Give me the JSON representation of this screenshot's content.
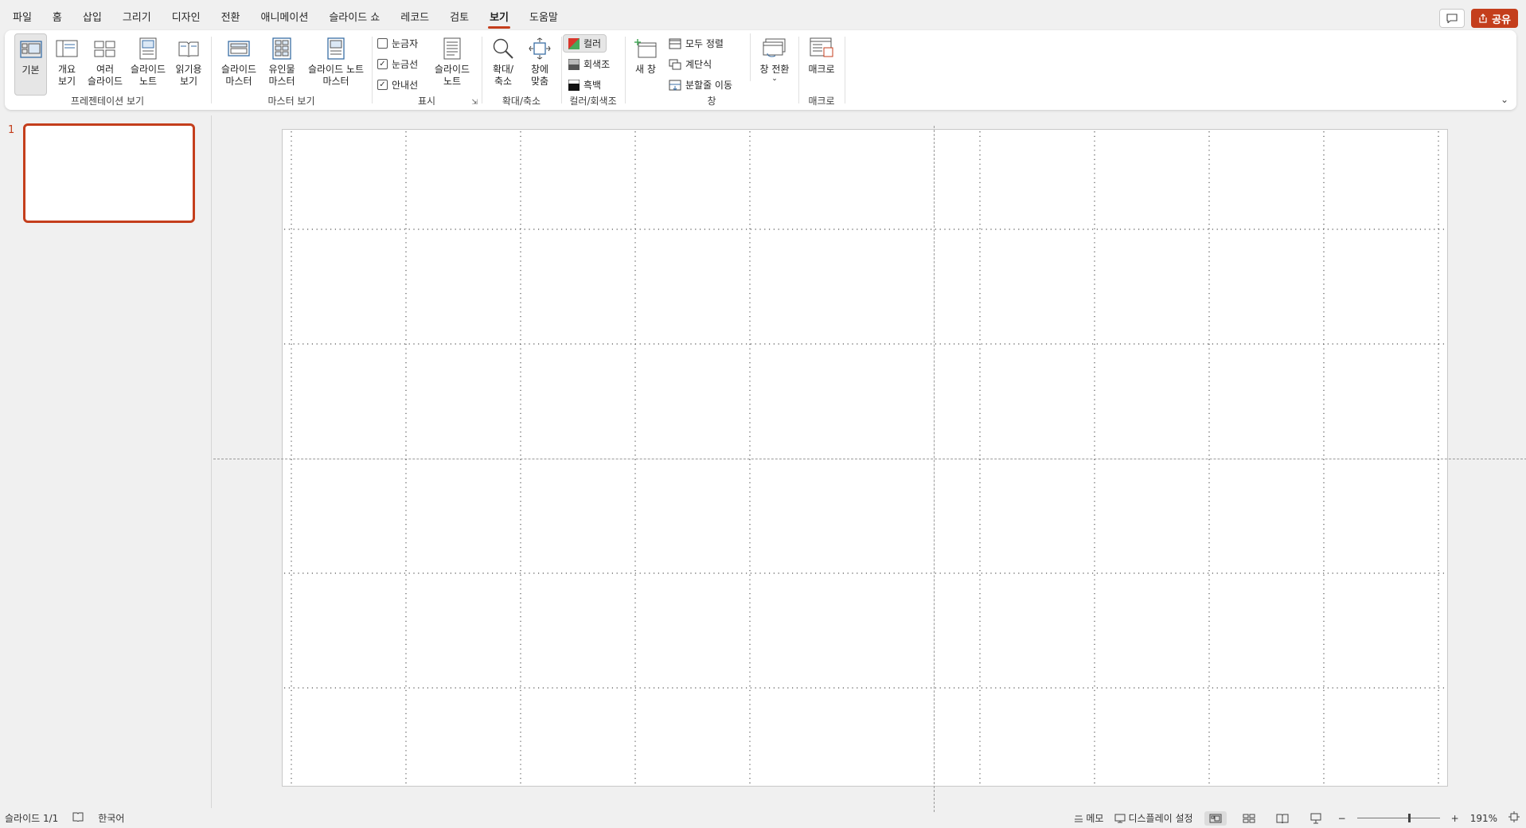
{
  "menu": {
    "items": [
      "파일",
      "홈",
      "삽입",
      "그리기",
      "디자인",
      "전환",
      "애니메이션",
      "슬라이드 쇼",
      "레코드",
      "검토",
      "보기",
      "도움말"
    ],
    "active": "보기",
    "share_label": "공유"
  },
  "ribbon": {
    "presentation_views": {
      "label": "프레젠테이션 보기",
      "normal": "기본",
      "outline": "개요\n보기",
      "sorter": "여러\n슬라이드",
      "notes_page": "슬라이드\n노트",
      "reading": "읽기용\n보기"
    },
    "master_views": {
      "label": "마스터 보기",
      "slide_master": "슬라이드\n마스터",
      "handout_master": "유인물\n마스터",
      "notes_master": "슬라이드 노트\n마스터"
    },
    "show": {
      "label": "표시",
      "ruler": "눈금자",
      "ruler_checked": false,
      "gridlines": "눈금선",
      "gridlines_checked": true,
      "guides": "안내선",
      "guides_checked": true,
      "notes": "슬라이드\n노트"
    },
    "zoom": {
      "label": "확대/축소",
      "zoom": "확대/\n축소",
      "fit": "창에\n맞춤"
    },
    "color": {
      "label": "컬러/회색조",
      "color": "컬러",
      "grayscale": "회색조",
      "bw": "흑백"
    },
    "window": {
      "label": "창",
      "new_window": "새 창",
      "arrange_all": "모두 정렬",
      "cascade": "계단식",
      "move_split": "분할줄 이동",
      "switch": "창 전환"
    },
    "macros": {
      "label": "매크로",
      "macros": "매크로"
    }
  },
  "thumbnails": {
    "slide_number": "1"
  },
  "statusbar": {
    "slide_info": "슬라이드 1/1",
    "language": "한국어",
    "notes": "메모",
    "display": "디스플레이 설정",
    "zoom_minus": "−",
    "zoom_plus": "+",
    "zoom_level": "191%"
  },
  "colors": {
    "accent": "#c43e1c"
  }
}
